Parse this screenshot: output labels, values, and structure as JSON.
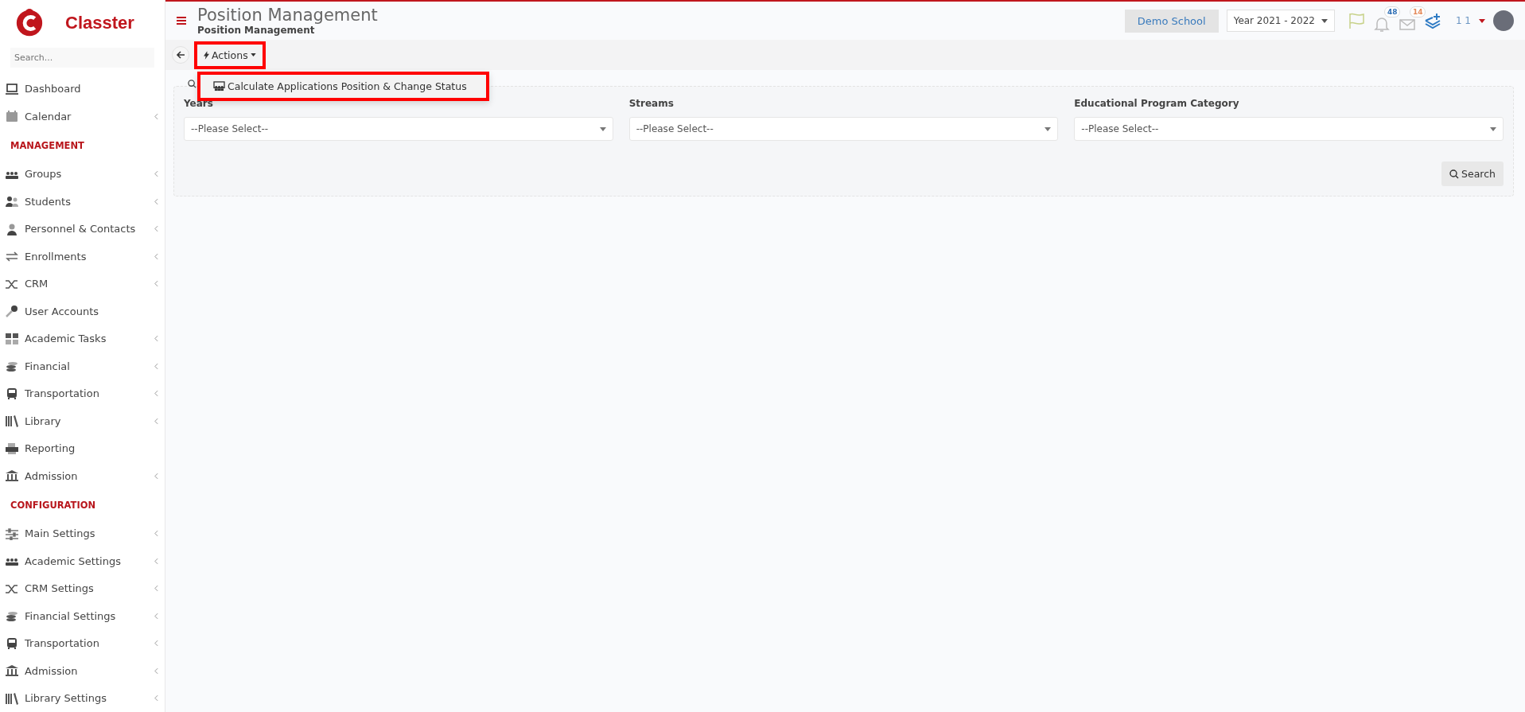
{
  "brand": {
    "name": "Classter"
  },
  "sidebar": {
    "search": {
      "placeholder": "Search..."
    },
    "items": [
      {
        "kind": "item",
        "label": "Dashboard",
        "has_submenu": false
      },
      {
        "kind": "item",
        "label": "Calendar",
        "has_submenu": true
      },
      {
        "kind": "section",
        "label": "MANAGEMENT"
      },
      {
        "kind": "item",
        "label": "Groups",
        "has_submenu": true
      },
      {
        "kind": "item",
        "label": "Students",
        "has_submenu": true
      },
      {
        "kind": "item",
        "label": "Personnel & Contacts",
        "has_submenu": true
      },
      {
        "kind": "item",
        "label": "Enrollments",
        "has_submenu": true
      },
      {
        "kind": "item",
        "label": "CRM",
        "has_submenu": true
      },
      {
        "kind": "item",
        "label": "User Accounts",
        "has_submenu": false
      },
      {
        "kind": "item",
        "label": "Academic Tasks",
        "has_submenu": true
      },
      {
        "kind": "item",
        "label": "Financial",
        "has_submenu": true
      },
      {
        "kind": "item",
        "label": "Transportation",
        "has_submenu": true
      },
      {
        "kind": "item",
        "label": "Library",
        "has_submenu": true
      },
      {
        "kind": "item",
        "label": "Reporting",
        "has_submenu": false
      },
      {
        "kind": "item",
        "label": "Admission",
        "has_submenu": true
      },
      {
        "kind": "section",
        "label": "CONFIGURATION"
      },
      {
        "kind": "item",
        "label": "Main Settings",
        "has_submenu": true
      },
      {
        "kind": "item",
        "label": "Academic Settings",
        "has_submenu": true
      },
      {
        "kind": "item",
        "label": "CRM Settings",
        "has_submenu": true
      },
      {
        "kind": "item",
        "label": "Financial Settings",
        "has_submenu": true
      },
      {
        "kind": "item",
        "label": "Transportation",
        "has_submenu": true
      },
      {
        "kind": "item",
        "label": "Admission",
        "has_submenu": true
      },
      {
        "kind": "item",
        "label": "Library Settings",
        "has_submenu": true
      }
    ]
  },
  "header": {
    "title": "Position Management",
    "breadcrumb": "Position Management",
    "school": "Demo School",
    "year": "Year 2021 - 2022",
    "notifications": "48",
    "messages": "14",
    "user": "1 1"
  },
  "toolbar": {
    "actions": {
      "label": "Actions",
      "highlighted": true
    },
    "menu": [
      {
        "label": "Calculate Applications Position & Change Status",
        "highlighted": true
      }
    ]
  },
  "filters": [
    {
      "label": "Years",
      "placeholder": "--Please Select--"
    },
    {
      "label": "Streams",
      "placeholder": "--Please Select--"
    },
    {
      "label": "Educational Program Category",
      "placeholder": "--Please Select--"
    }
  ],
  "search_button": "Search"
}
